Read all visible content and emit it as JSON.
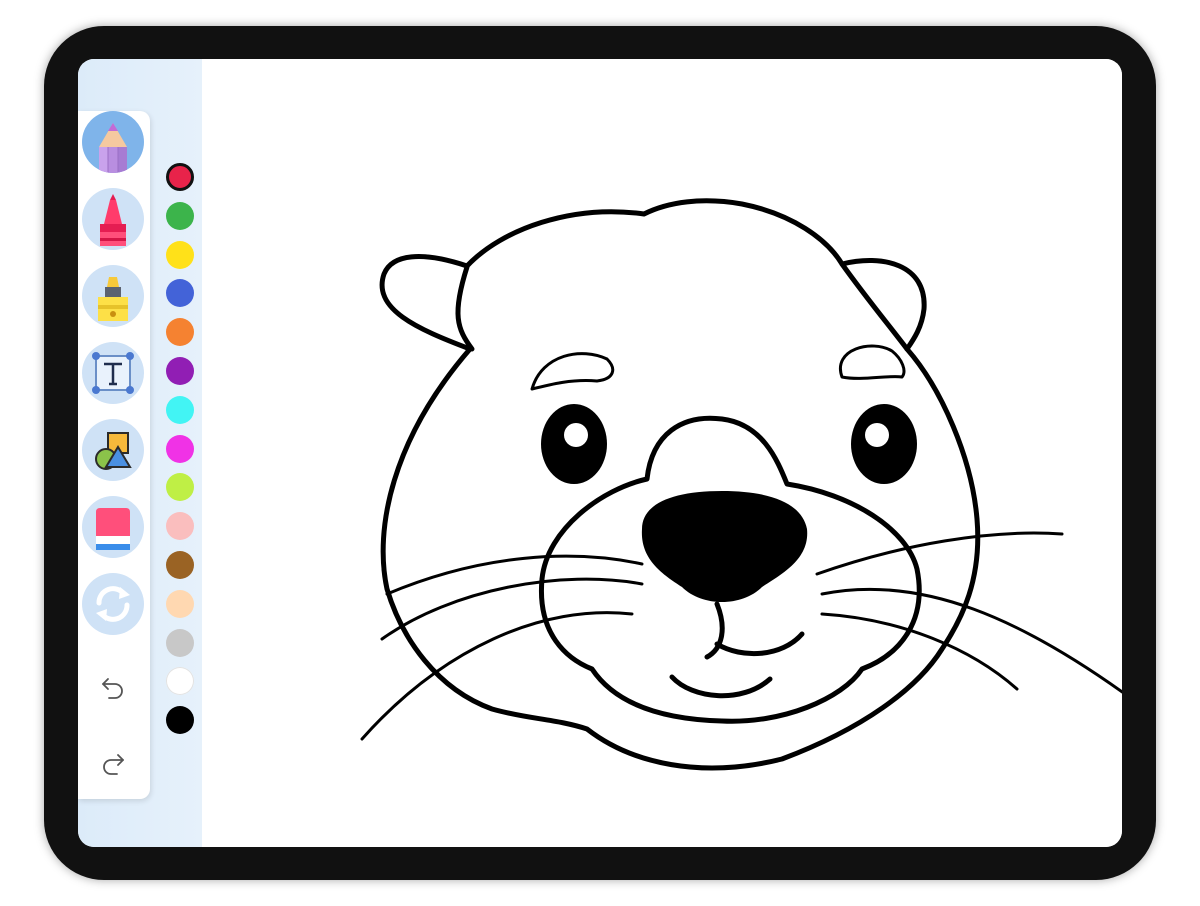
{
  "app": {
    "screen": "coloring-page"
  },
  "tools": [
    {
      "id": "pencil",
      "icon": "pencil-icon",
      "active": true
    },
    {
      "id": "crayon",
      "icon": "crayon-icon",
      "active": false
    },
    {
      "id": "marker",
      "icon": "marker-icon",
      "active": false
    },
    {
      "id": "text",
      "icon": "text-tool-icon",
      "active": false
    },
    {
      "id": "shapes",
      "icon": "shapes-icon",
      "active": false
    },
    {
      "id": "eraser",
      "icon": "eraser-icon",
      "active": false
    },
    {
      "id": "reset",
      "icon": "refresh-icon",
      "active": false
    }
  ],
  "history": [
    {
      "id": "undo",
      "icon": "undo-icon"
    },
    {
      "id": "redo",
      "icon": "redo-icon"
    }
  ],
  "palette": {
    "selected_index": 0,
    "colors": [
      "#e8234a",
      "#3cb44b",
      "#ffe119",
      "#4363d8",
      "#f58231",
      "#911eb4",
      "#42f4f4",
      "#f032e6",
      "#bfef45",
      "#fabebe",
      "#9a6324",
      "#ffd8b1",
      "#c8c8c8",
      "#ffffff",
      "#000000"
    ]
  },
  "canvas": {
    "subject": "otter-outline"
  },
  "colors": {
    "bezel": "#111111",
    "sidebar_bg": "#dcebf9",
    "tool_circle": "#cfe2f6",
    "tool_active": "#7fb4ea"
  }
}
